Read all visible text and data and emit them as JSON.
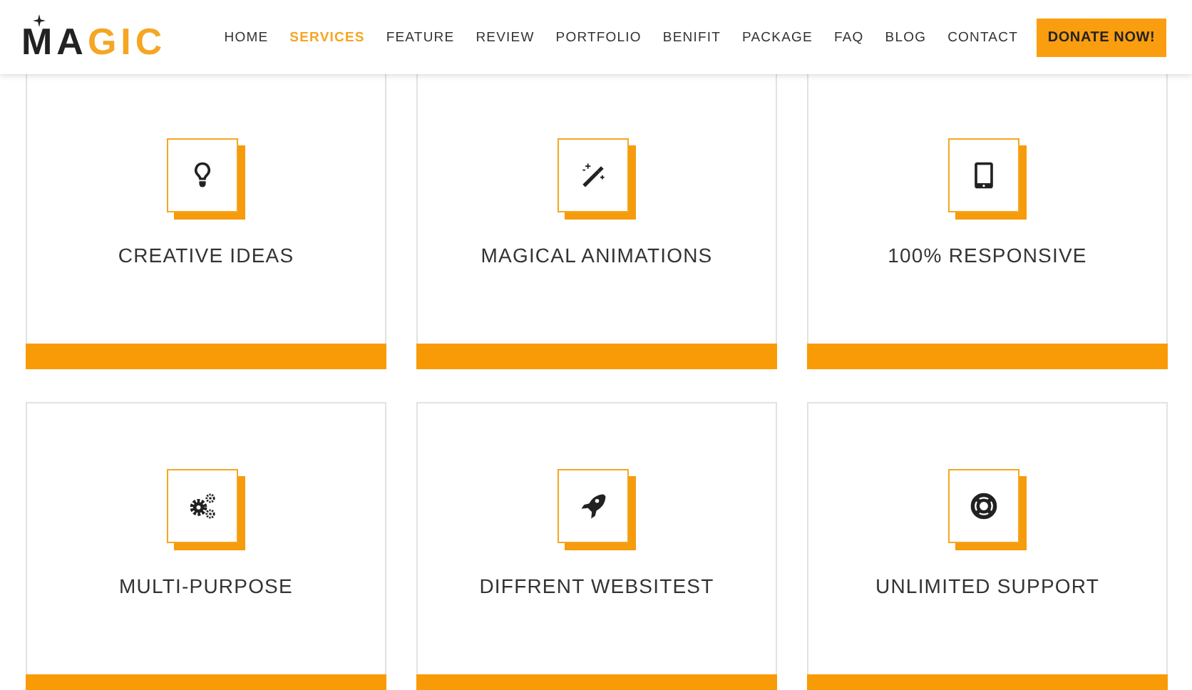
{
  "logo": {
    "dark": "MA",
    "accent": "GIC"
  },
  "nav": [
    {
      "label": "HOME",
      "selected": false
    },
    {
      "label": "SERVICES",
      "selected": true
    },
    {
      "label": "FEATURE",
      "selected": false
    },
    {
      "label": "REVIEW",
      "selected": false
    },
    {
      "label": "PORTFOLIO",
      "selected": false
    },
    {
      "label": "BENIFIT",
      "selected": false
    },
    {
      "label": "PACKAGE",
      "selected": false
    },
    {
      "label": "FAQ",
      "selected": false
    },
    {
      "label": "BLOG",
      "selected": false
    },
    {
      "label": "CONTACT",
      "selected": false
    }
  ],
  "cta": "DONATE NOW!",
  "services": [
    {
      "kind": "bulb",
      "title": "CREATIVE IDEAS"
    },
    {
      "kind": "wand",
      "title": "MAGICAL ANIMATIONS"
    },
    {
      "kind": "tablet",
      "title": "100% RESPONSIVE"
    },
    {
      "kind": "gears",
      "title": "MULTI-PURPOSE"
    },
    {
      "kind": "rocket",
      "title": "DIFFRENT WEBSITEST"
    },
    {
      "kind": "lifebuoy",
      "title": "UNLIMITED SUPPORT"
    }
  ]
}
